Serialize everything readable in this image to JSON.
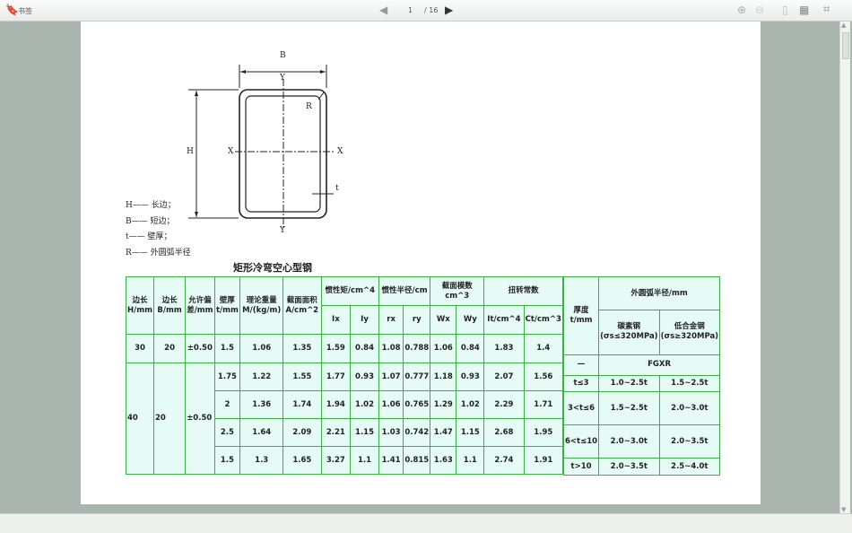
{
  "toolbar": {
    "bookmark_label": "书签",
    "page_current": "1",
    "page_total": "/ 16"
  },
  "figure": {
    "B": "B",
    "H": "H",
    "Y_top": "Y",
    "Y_bottom": "Y",
    "X_left": "X",
    "X_right": "X",
    "R": "R",
    "t": "t",
    "legend": [
      "H—— 长边；",
      "B—— 短边；",
      "t—— 壁厚；",
      "R—— 外圆弧半径"
    ],
    "caption": "矩形冷弯空心型钢"
  },
  "table": {
    "headers": {
      "h": "边长H/mm",
      "b": "边长B/mm",
      "tol": "允许偏差/mm",
      "t": "壁厚t/mm",
      "m": "理论重量M/(kg/m)",
      "a": "截面面积A/cm^2",
      "inertia": "惯性矩/cm^4",
      "radius": "惯性半径/cm",
      "modulus": "截面模数cm^3",
      "torsion": "扭转常数",
      "ix": "Ix",
      "iy": "Iy",
      "rx": "rx",
      "ry": "ry",
      "wx": "Wx",
      "wy": "Wy",
      "it": "It/cm^4",
      "ct": "Ct/cm^3"
    },
    "group1": {
      "h": "30",
      "b": "20",
      "tol": "±0.50",
      "rows": [
        [
          "1.5",
          "1.06",
          "1.35",
          "1.59",
          "0.84",
          "1.08",
          "0.788",
          "1.06",
          "0.84",
          "1.83",
          "1.4"
        ]
      ]
    },
    "group2": {
      "h": "40",
      "b": "20",
      "tol": "±0.50",
      "rows": [
        [
          "1.75",
          "1.22",
          "1.55",
          "1.77",
          "0.93",
          "1.07",
          "0.777",
          "1.18",
          "0.93",
          "2.07",
          "1.56"
        ],
        [
          "2",
          "1.36",
          "1.74",
          "1.94",
          "1.02",
          "1.06",
          "0.765",
          "1.29",
          "1.02",
          "2.29",
          "1.71"
        ],
        [
          "2.5",
          "1.64",
          "2.09",
          "2.21",
          "1.15",
          "1.03",
          "0.742",
          "1.47",
          "1.15",
          "2.68",
          "1.95"
        ],
        [
          "1.5",
          "1.3",
          "1.65",
          "3.27",
          "1.1",
          "1.41",
          "0.815",
          "1.63",
          "1.1",
          "2.74",
          "1.91"
        ]
      ]
    }
  },
  "radius_table": {
    "thickness": "厚度t/mm",
    "outer": "外圆弧半径/mm",
    "carbon": "碳素钢(σs≤320MPa)",
    "alloy": "低合金钢(σs≥320MPa)",
    "dash": "—",
    "fgxr": "FGXR",
    "rows": [
      [
        "t≤3",
        "1.0~2.5t",
        "1.5~2.5t"
      ],
      [
        "3<t≤6",
        "1.5~2.5t",
        "2.0~3.0t"
      ],
      [
        "6<t≤10",
        "2.0~3.0t",
        "2.0~3.5t"
      ],
      [
        "t>10",
        "2.0~3.5t",
        "2.5~4.0t"
      ]
    ]
  },
  "colors": {
    "table_bg": "#e7fbf6",
    "table_border": "#3fae47",
    "backdrop": "#a9b5ae"
  }
}
